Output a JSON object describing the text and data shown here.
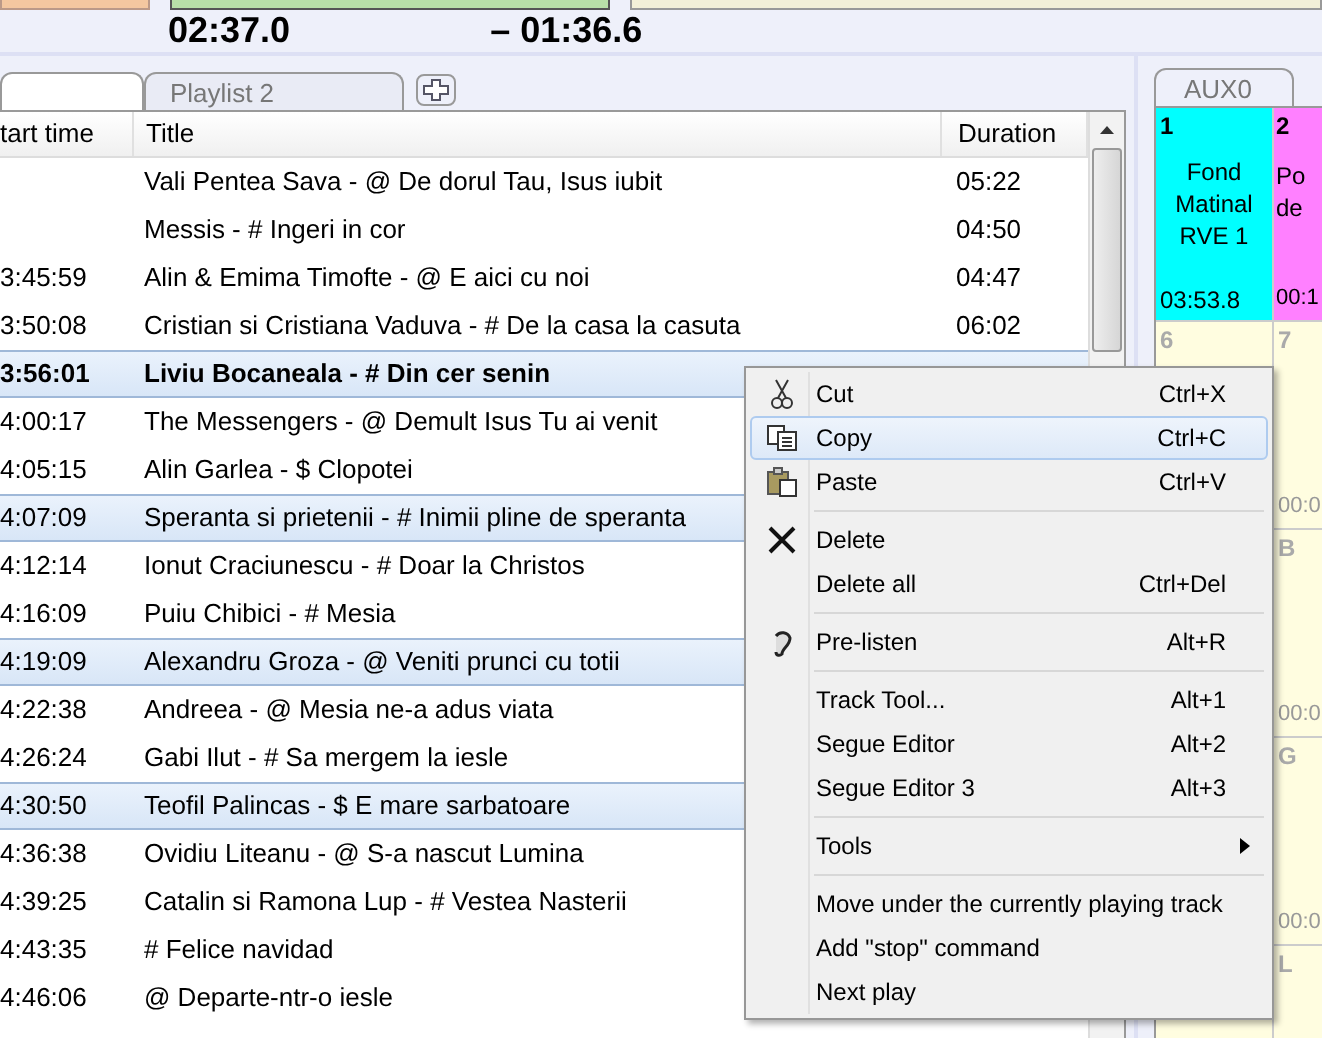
{
  "timers": {
    "elapsed": "02:37.0",
    "remaining": "– 01:36.6"
  },
  "tabs": [
    {
      "selected": true
    },
    {
      "label": "Playlist 2",
      "selected": false
    }
  ],
  "playlist": {
    "columns": [
      "tart time",
      "Title",
      "Duration"
    ],
    "rows": [
      {
        "title": "Vali Pentea Sava - @ De dorul Tau, Isus iubit",
        "duration": "05:22",
        "selected": false,
        "playing": false
      },
      {
        "title": "Messis - # Ingeri in cor",
        "duration": "04:50",
        "selected": false,
        "playing": false
      },
      {
        "start": "3:45:59",
        "title": "Alin & Emima Timofte - @ E aici cu noi",
        "duration": "04:47",
        "selected": false,
        "playing": false
      },
      {
        "start": "3:50:08",
        "title": "Cristian si Cristiana Vaduva - # De la casa la casuta",
        "duration": "06:02",
        "selected": false,
        "playing": false
      },
      {
        "start": "3:56:01",
        "title": "Liviu Bocaneala - # Din cer senin",
        "selected": true,
        "playing": true
      },
      {
        "start": "4:00:17",
        "title": "The Messengers - @ Demult Isus Tu ai venit",
        "selected": false,
        "playing": false
      },
      {
        "start": "4:05:15",
        "title": "Alin Garlea - $ Clopotei",
        "selected": false,
        "playing": false
      },
      {
        "start": "4:07:09",
        "title": "Speranta si prietenii - # Inimii pline de speranta",
        "selected": true,
        "playing": false
      },
      {
        "start": "4:12:14",
        "title": "Ionut Craciunescu - # Doar la Christos",
        "selected": false,
        "playing": false
      },
      {
        "start": "4:16:09",
        "title": "Puiu Chibici - # Mesia",
        "selected": false,
        "playing": false
      },
      {
        "start": "4:19:09",
        "title": "Alexandru Groza - @ Veniti prunci cu totii",
        "selected": true,
        "playing": false
      },
      {
        "start": "4:22:38",
        "title": "Andreea - @ Mesia ne-a adus viata",
        "selected": false,
        "playing": false
      },
      {
        "start": "4:26:24",
        "title": "Gabi Ilut - # Sa mergem la iesle",
        "selected": false,
        "playing": false
      },
      {
        "start": "4:30:50",
        "title": "Teofil Palincas - $ E mare sarbatoare",
        "selected": true,
        "playing": false
      },
      {
        "start": "4:36:38",
        "title": "Ovidiu  Liteanu - @ S-a  nascut  Lumina",
        "selected": false,
        "playing": false
      },
      {
        "start": "4:39:25",
        "title": "Catalin si Ramona Lup - # Vestea Nasterii",
        "selected": false,
        "playing": false
      },
      {
        "start": "4:43:35",
        "title": "# Felice navidad",
        "selected": false,
        "playing": false
      },
      {
        "start": "4:46:06",
        "title": "@ Departe-ntr-o iesle",
        "selected": false,
        "playing": false
      }
    ]
  },
  "aux": {
    "tab": "AUX0",
    "cells": [
      {
        "number": "1",
        "title": "Fond Matinal RVE 1",
        "time": "03:53.8",
        "color": "#00ffff"
      },
      {
        "number": "2",
        "title": "Po de",
        "time": "00:1",
        "color": "#ff80ff"
      },
      {
        "number": "6",
        "color": "#fffde0"
      },
      {
        "number": "7",
        "time": "00:0",
        "color": "#fffde0"
      },
      {
        "number": "B",
        "time": "00:0",
        "color": "#fffde0"
      },
      {
        "number": "G",
        "time": "00:0",
        "color": "#fffde0"
      },
      {
        "number": "L",
        "color": "#fffde0"
      }
    ]
  },
  "context_menu": [
    {
      "kind": "item",
      "label": "Cut",
      "shortcut": "Ctrl+X",
      "selected": false,
      "submenu": false
    },
    {
      "kind": "item",
      "label": "Copy",
      "shortcut": "Ctrl+C",
      "selected": true,
      "submenu": false
    },
    {
      "kind": "item",
      "label": "Paste",
      "shortcut": "Ctrl+V",
      "selected": false,
      "submenu": false
    },
    {
      "kind": "separator"
    },
    {
      "kind": "item",
      "label": "Delete",
      "selected": false,
      "submenu": false
    },
    {
      "kind": "item",
      "label": "Delete all",
      "shortcut": "Ctrl+Del",
      "selected": false,
      "submenu": false
    },
    {
      "kind": "separator"
    },
    {
      "kind": "item",
      "label": "Pre-listen",
      "shortcut": "Alt+R",
      "selected": false,
      "submenu": false
    },
    {
      "kind": "separator"
    },
    {
      "kind": "item",
      "label": "Track Tool...",
      "shortcut": "Alt+1",
      "selected": false,
      "submenu": false
    },
    {
      "kind": "item",
      "label": "Segue Editor",
      "shortcut": "Alt+2",
      "selected": false,
      "submenu": false
    },
    {
      "kind": "item",
      "label": "Segue Editor 3",
      "shortcut": "Alt+3",
      "selected": false,
      "submenu": false
    },
    {
      "kind": "separator"
    },
    {
      "kind": "item",
      "label": "Tools",
      "selected": false,
      "submenu": true
    },
    {
      "kind": "separator"
    },
    {
      "kind": "item",
      "label": "Move under the currently playing track",
      "selected": false,
      "submenu": false
    },
    {
      "kind": "item",
      "label": "Add \"stop\" command",
      "selected": false,
      "submenu": false
    },
    {
      "kind": "item",
      "label": "Next play",
      "selected": false,
      "submenu": false
    }
  ]
}
